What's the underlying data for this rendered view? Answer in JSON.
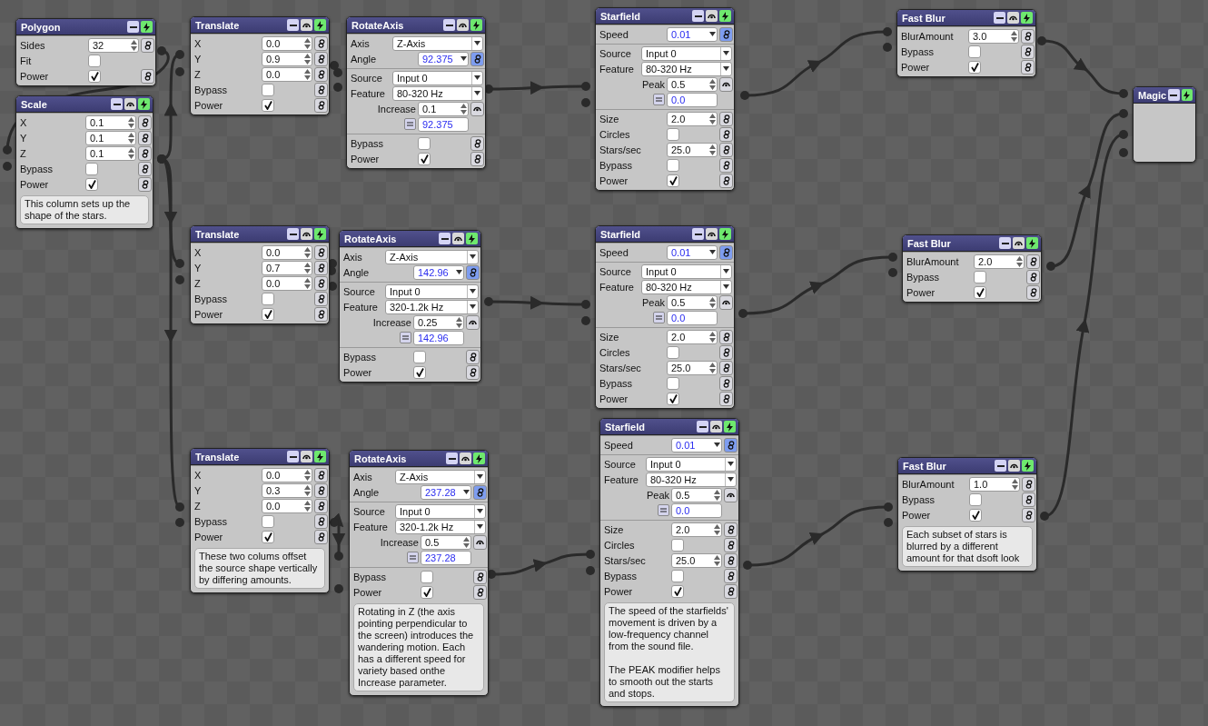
{
  "nodes": [
    {
      "title": "Polygon",
      "sensor": false,
      "sections": [
        [
          {
            "kind": "number",
            "label": "Sides",
            "value": "32"
          },
          {
            "kind": "flag",
            "label": "Fit",
            "checked": false
          },
          {
            "kind": "check",
            "label": "Power",
            "checked": true
          }
        ]
      ]
    },
    {
      "title": "Scale",
      "sensor": true,
      "sections": [
        [
          {
            "kind": "number",
            "label": "X",
            "value": "0.1"
          },
          {
            "kind": "number",
            "label": "Y",
            "value": "0.1"
          },
          {
            "kind": "number",
            "label": "Z",
            "value": "0.1"
          },
          {
            "kind": "check",
            "label": "Bypass",
            "checked": false
          },
          {
            "kind": "check",
            "label": "Power",
            "checked": true
          }
        ]
      ],
      "note": "This column sets up the shape of the stars."
    },
    {
      "title": "Translate",
      "sensor": true,
      "sections": [
        [
          {
            "kind": "number",
            "label": "X",
            "value": "0.0"
          },
          {
            "kind": "number",
            "label": "Y",
            "value": "0.9"
          },
          {
            "kind": "number",
            "label": "Z",
            "value": "0.0"
          },
          {
            "kind": "check",
            "label": "Bypass",
            "checked": false
          },
          {
            "kind": "check",
            "label": "Power",
            "checked": true
          }
        ]
      ]
    },
    {
      "title": "RotateAxis",
      "sensor": true,
      "sections": [
        [
          {
            "kind": "select",
            "label": "Axis",
            "value": "Z-Axis"
          },
          {
            "kind": "linked",
            "label": "Angle",
            "value": "92.375"
          }
        ],
        [
          {
            "kind": "select",
            "label": "Source",
            "value": "Input 0"
          },
          {
            "kind": "select",
            "label": "Feature",
            "value": "80-320 Hz"
          },
          {
            "kind": "modifier",
            "label": "Increase",
            "value": "0.1"
          },
          {
            "kind": "result",
            "value": "92.375"
          }
        ],
        [
          {
            "kind": "check",
            "label": "Bypass",
            "checked": false
          },
          {
            "kind": "check",
            "label": "Power",
            "checked": true
          }
        ]
      ]
    },
    {
      "title": "Starfield",
      "sensor": true,
      "sections": [
        [
          {
            "kind": "linked",
            "label": "Speed",
            "value": "0.01"
          }
        ],
        [
          {
            "kind": "select",
            "label": "Source",
            "value": "Input 0"
          },
          {
            "kind": "select",
            "label": "Feature",
            "value": "80-320 Hz"
          },
          {
            "kind": "modifier",
            "label": "Peak",
            "value": "0.5"
          },
          {
            "kind": "result",
            "value": "0.0"
          }
        ],
        [
          {
            "kind": "number",
            "label": "Size",
            "value": "2.0"
          },
          {
            "kind": "check",
            "label": "Circles",
            "checked": false
          },
          {
            "kind": "number",
            "label": "Stars/sec",
            "value": "25.0"
          },
          {
            "kind": "check",
            "label": "Bypass",
            "checked": false
          },
          {
            "kind": "check",
            "label": "Power",
            "checked": true
          }
        ]
      ]
    },
    {
      "title": "Fast Blur",
      "sensor": true,
      "sections": [
        [
          {
            "kind": "number",
            "label": "BlurAmount",
            "value": "3.0"
          },
          {
            "kind": "check",
            "label": "Bypass",
            "checked": false
          },
          {
            "kind": "check",
            "label": "Power",
            "checked": true
          }
        ]
      ]
    },
    {
      "title": "Magic",
      "sensor": false
    },
    {
      "title": "Translate",
      "sensor": true,
      "sections": [
        [
          {
            "kind": "number",
            "label": "X",
            "value": "0.0"
          },
          {
            "kind": "number",
            "label": "Y",
            "value": "0.7"
          },
          {
            "kind": "number",
            "label": "Z",
            "value": "0.0"
          },
          {
            "kind": "check",
            "label": "Bypass",
            "checked": false
          },
          {
            "kind": "check",
            "label": "Power",
            "checked": true
          }
        ]
      ]
    },
    {
      "title": "RotateAxis",
      "sensor": true,
      "sections": [
        [
          {
            "kind": "select",
            "label": "Axis",
            "value": "Z-Axis"
          },
          {
            "kind": "linked",
            "label": "Angle",
            "value": "142.96"
          }
        ],
        [
          {
            "kind": "select",
            "label": "Source",
            "value": "Input 0"
          },
          {
            "kind": "select",
            "label": "Feature",
            "value": "320-1.2k Hz"
          },
          {
            "kind": "modifier",
            "label": "Increase",
            "value": "0.25"
          },
          {
            "kind": "result",
            "value": "142.96"
          }
        ],
        [
          {
            "kind": "check",
            "label": "Bypass",
            "checked": false
          },
          {
            "kind": "check",
            "label": "Power",
            "checked": true
          }
        ]
      ]
    },
    {
      "title": "Starfield",
      "sensor": true,
      "sections": [
        [
          {
            "kind": "linked",
            "label": "Speed",
            "value": "0.01"
          }
        ],
        [
          {
            "kind": "select",
            "label": "Source",
            "value": "Input 0"
          },
          {
            "kind": "select",
            "label": "Feature",
            "value": "80-320 Hz"
          },
          {
            "kind": "modifier",
            "label": "Peak",
            "value": "0.5"
          },
          {
            "kind": "result",
            "value": "0.0"
          }
        ],
        [
          {
            "kind": "number",
            "label": "Size",
            "value": "2.0"
          },
          {
            "kind": "check",
            "label": "Circles",
            "checked": false
          },
          {
            "kind": "number",
            "label": "Stars/sec",
            "value": "25.0"
          },
          {
            "kind": "check",
            "label": "Bypass",
            "checked": false
          },
          {
            "kind": "check",
            "label": "Power",
            "checked": true
          }
        ]
      ]
    },
    {
      "title": "Fast Blur",
      "sensor": true,
      "sections": [
        [
          {
            "kind": "number",
            "label": "BlurAmount",
            "value": "2.0"
          },
          {
            "kind": "check",
            "label": "Bypass",
            "checked": false
          },
          {
            "kind": "check",
            "label": "Power",
            "checked": true
          }
        ]
      ]
    },
    {
      "title": "Translate",
      "sensor": true,
      "sections": [
        [
          {
            "kind": "number",
            "label": "X",
            "value": "0.0"
          },
          {
            "kind": "number",
            "label": "Y",
            "value": "0.3"
          },
          {
            "kind": "number",
            "label": "Z",
            "value": "0.0"
          },
          {
            "kind": "check",
            "label": "Bypass",
            "checked": false
          },
          {
            "kind": "check",
            "label": "Power",
            "checked": true
          }
        ]
      ],
      "note": "These two colums offset the source shape vertically by differing amounts."
    },
    {
      "title": "RotateAxis",
      "sensor": true,
      "sections": [
        [
          {
            "kind": "select",
            "label": "Axis",
            "value": "Z-Axis"
          },
          {
            "kind": "linked",
            "label": "Angle",
            "value": "237.28"
          }
        ],
        [
          {
            "kind": "select",
            "label": "Source",
            "value": "Input 0"
          },
          {
            "kind": "select",
            "label": "Feature",
            "value": "320-1.2k Hz"
          },
          {
            "kind": "modifier",
            "label": "Increase",
            "value": "0.5"
          },
          {
            "kind": "result",
            "value": "237.28"
          }
        ],
        [
          {
            "kind": "check",
            "label": "Bypass",
            "checked": false
          },
          {
            "kind": "check",
            "label": "Power",
            "checked": true
          }
        ]
      ],
      "note": "Rotating in Z (the axis pointing perpendicular to the screen) introduces the wandering motion. Each has a different speed for variety based onthe Increase parameter."
    },
    {
      "title": "Starfield",
      "sensor": true,
      "sections": [
        [
          {
            "kind": "linked",
            "label": "Speed",
            "value": "0.01"
          }
        ],
        [
          {
            "kind": "select",
            "label": "Source",
            "value": "Input 0"
          },
          {
            "kind": "select",
            "label": "Feature",
            "value": "80-320 Hz"
          },
          {
            "kind": "modifier",
            "label": "Peak",
            "value": "0.5"
          },
          {
            "kind": "result",
            "value": "0.0"
          }
        ],
        [
          {
            "kind": "number",
            "label": "Size",
            "value": "2.0"
          },
          {
            "kind": "check",
            "label": "Circles",
            "checked": false
          },
          {
            "kind": "number",
            "label": "Stars/sec",
            "value": "25.0"
          },
          {
            "kind": "check",
            "label": "Bypass",
            "checked": false
          },
          {
            "kind": "check",
            "label": "Power",
            "checked": true
          }
        ]
      ],
      "note": "The speed of the starfields' movement is driven by a low-frequency channel from the sound file.\n\nThe PEAK modifier helps to smooth out the starts and stops."
    },
    {
      "title": "Fast Blur",
      "sensor": true,
      "sections": [
        [
          {
            "kind": "number",
            "label": "BlurAmount",
            "value": "1.0"
          },
          {
            "kind": "check",
            "label": "Bypass",
            "checked": false
          },
          {
            "kind": "check",
            "label": "Power",
            "checked": true
          }
        ]
      ],
      "note": "Each subset of stars is blurred by a different amount for that dsoft look"
    }
  ]
}
